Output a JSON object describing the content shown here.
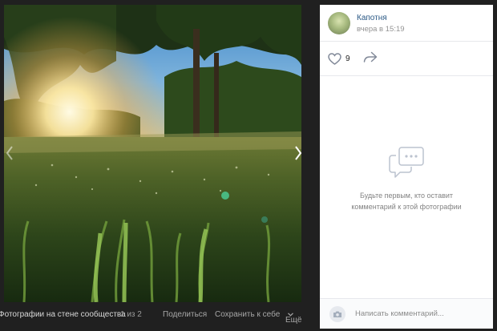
{
  "post": {
    "author": "Капотня",
    "date": "вчера в 15:19",
    "likes": "9"
  },
  "comments": {
    "empty_line1": "Будьте первым, кто оставит",
    "empty_line2": "комментарий к этой фотографии",
    "placeholder": "Написать комментарий..."
  },
  "bottom_bar": {
    "album": "Фотографии на стене сообщества",
    "counter": "1 из 2",
    "share": "Поделиться",
    "save": "Сохранить к себе",
    "more": "Ещё"
  },
  "icons": {
    "like": "heart-icon",
    "share": "share-arrow-icon",
    "comments_empty": "speech-bubble-icon",
    "camera": "camera-icon",
    "prev": "chevron-left-icon",
    "next": "chevron-right-icon",
    "more": "chevron-down-icon"
  },
  "colors": {
    "link": "#2a5885",
    "muted": "#939393",
    "icon": "#828a99",
    "viewer_bg": "#202020"
  }
}
